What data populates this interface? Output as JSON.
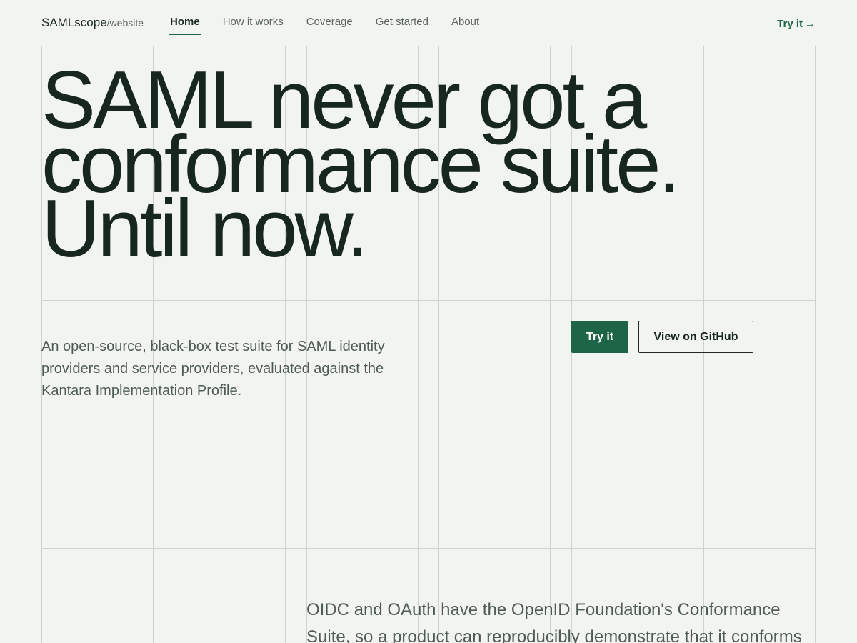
{
  "header": {
    "brand": "SAMLscope",
    "brand_suffix": "/website",
    "nav": [
      {
        "label": "Home",
        "active": true
      },
      {
        "label": "How it works",
        "active": false
      },
      {
        "label": "Coverage",
        "active": false
      },
      {
        "label": "Get started",
        "active": false
      },
      {
        "label": "About",
        "active": false
      }
    ],
    "try_link": "Try it",
    "try_arrow": "→"
  },
  "hero": {
    "title_lines": [
      "SAML never got a",
      "conformance suite.",
      "Until now."
    ],
    "intro": "An open-source, black-box test suite for SAML identity providers and service providers, evaluated against the Kantara Implementation Profile.",
    "primary_button": "Try it",
    "secondary_button": "View on GitHub"
  },
  "section": {
    "text": "OIDC and OAuth have the OpenID Foundation's Conformance Suite, so a product can reproducibly demonstrate that it conforms"
  },
  "colors": {
    "background": "#f2f4f0",
    "accent": "#1d6546",
    "text": "#17261e",
    "muted": "#4f5b55",
    "gridline": "#cfd3cf"
  }
}
